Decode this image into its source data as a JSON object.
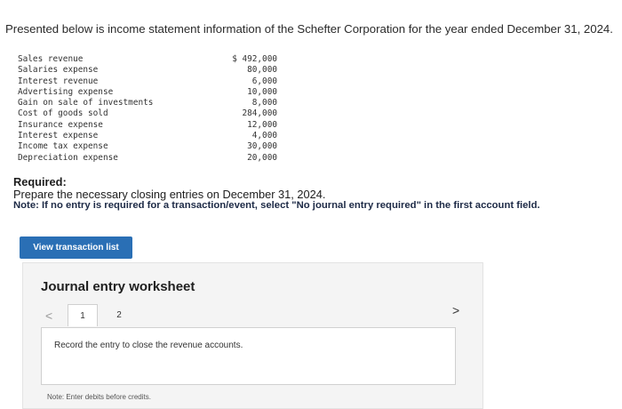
{
  "intro": "Presented below is income statement information of the Schefter Corporation for the year ended December 31, 2024.",
  "accounts": [
    {
      "label": "Sales revenue",
      "value": "$ 492,000"
    },
    {
      "label": "Salaries expense",
      "value": "80,000"
    },
    {
      "label": "Interest revenue",
      "value": "6,000"
    },
    {
      "label": "Advertising expense",
      "value": "10,000"
    },
    {
      "label": "Gain on sale of investments",
      "value": "8,000"
    },
    {
      "label": "Cost of goods sold",
      "value": "284,000"
    },
    {
      "label": "Insurance expense",
      "value": "12,000"
    },
    {
      "label": "Interest expense",
      "value": "4,000"
    },
    {
      "label": "Income tax expense",
      "value": "30,000"
    },
    {
      "label": "Depreciation expense",
      "value": "20,000"
    }
  ],
  "required": {
    "title": "Required:",
    "text": "Prepare the necessary closing entries on December 31, 2024.",
    "note": "Note: If no entry is required for a transaction/event, select \"No journal entry required\" in the first account field."
  },
  "view_button_label": "View transaction list",
  "worksheet": {
    "title": "Journal entry worksheet",
    "prev_glyph": "<",
    "next_glyph": ">",
    "tabs": [
      "1",
      "2"
    ],
    "instruction": "Record the entry to close the revenue accounts.",
    "note": "Note: Enter debits before credits."
  }
}
